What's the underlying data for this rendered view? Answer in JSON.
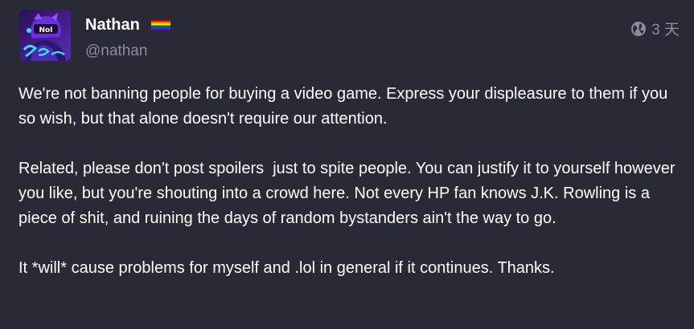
{
  "account": {
    "display_name": "Nathan",
    "flag_icon": "rainbow-pride-flag-icon",
    "handle": "@nathan",
    "avatar_icon": "purple-anime-character-avatar"
  },
  "meta": {
    "visibility_icon": "globe-icon",
    "relative_time": "3 天"
  },
  "post": {
    "paragraphs": [
      "We're not banning people for buying a video game. Express your displeasure to them if you so wish, but that alone doesn't require our attention.",
      "Related, please don't post spoilers  just to spite people. You can justify it to yourself however you like, but you're shouting into a crowd here. Not every HP fan knows J.K. Rowling is a piece of shit, and ruining the days of random bystanders ain't the way to go.",
      "It *will* cause problems for myself and .lol in general if it continues. Thanks."
    ]
  },
  "colors": {
    "background": "#282a36",
    "text": "#ffffff",
    "muted": "#8a8d9f",
    "avatar_bg": "#3a1e6e",
    "avatar_accent": "#7b3fe4"
  }
}
